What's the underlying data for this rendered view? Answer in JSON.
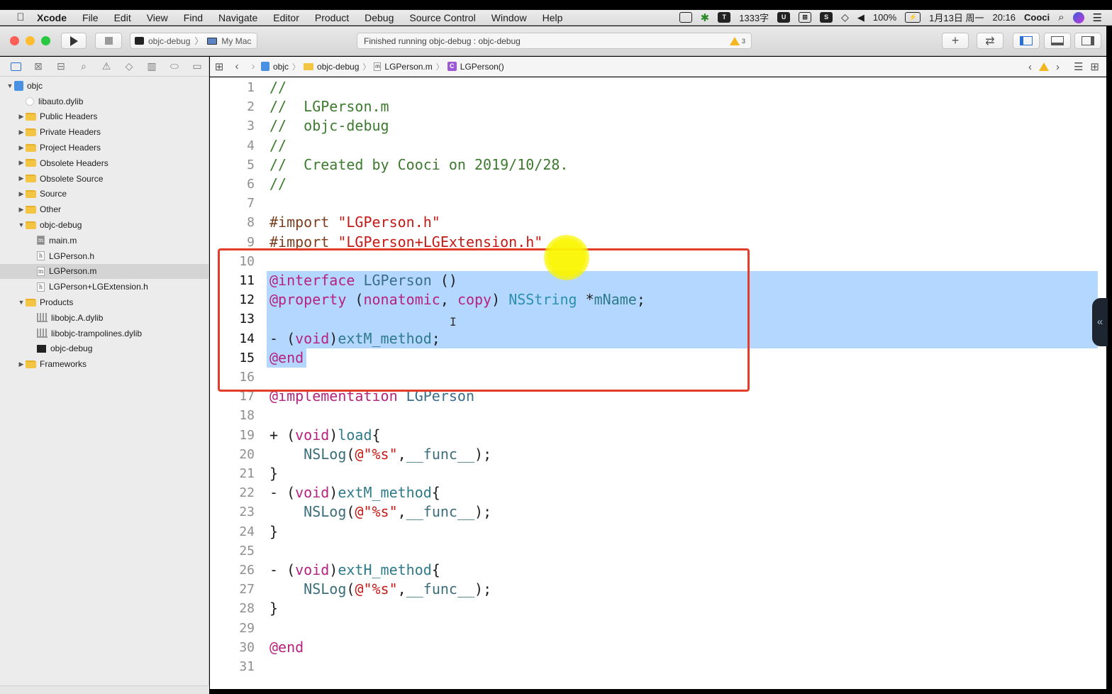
{
  "menubar": {
    "app": "Xcode",
    "items": [
      "File",
      "Edit",
      "View",
      "Find",
      "Navigate",
      "Editor",
      "Product",
      "Debug",
      "Source Control",
      "Window",
      "Help"
    ],
    "status": {
      "word_count": "1333字",
      "battery": "100%",
      "date": "1月13日 周一",
      "time": "20:16",
      "user": "Cooci"
    }
  },
  "toolbar": {
    "scheme": "objc-debug",
    "destination": "My Mac",
    "activity_text": "Finished running objc-debug : objc-debug",
    "warning_count": "3",
    "colors": {
      "close": "#fd5f57",
      "minimize": "#febc2e",
      "zoom": "#28c840"
    }
  },
  "navigator": {
    "tree": [
      {
        "label": "objc",
        "kind": "project",
        "disclosure": "open",
        "depth": 0
      },
      {
        "label": "libauto.dylib",
        "kind": "dylib",
        "disclosure": "none",
        "depth": 1
      },
      {
        "label": "Public Headers",
        "kind": "folder",
        "disclosure": "closed",
        "depth": 1
      },
      {
        "label": "Private Headers",
        "kind": "folder",
        "disclosure": "closed",
        "depth": 1
      },
      {
        "label": "Project Headers",
        "kind": "folder",
        "disclosure": "closed",
        "depth": 1
      },
      {
        "label": "Obsolete Headers",
        "kind": "folder",
        "disclosure": "closed",
        "depth": 1
      },
      {
        "label": "Obsolete Source",
        "kind": "folder",
        "disclosure": "closed",
        "depth": 1
      },
      {
        "label": "Source",
        "kind": "folder",
        "disclosure": "closed",
        "depth": 1
      },
      {
        "label": "Other",
        "kind": "folder",
        "disclosure": "closed",
        "depth": 1
      },
      {
        "label": "objc-debug",
        "kind": "folder",
        "disclosure": "open",
        "depth": 1
      },
      {
        "label": "main.m",
        "kind": "file-m-dark",
        "disclosure": "none",
        "depth": 2
      },
      {
        "label": "LGPerson.h",
        "kind": "file-h",
        "disclosure": "none",
        "depth": 2
      },
      {
        "label": "LGPerson.m",
        "kind": "file-m",
        "disclosure": "none",
        "depth": 2,
        "selected": true
      },
      {
        "label": "LGPerson+LGExtension.h",
        "kind": "file-h",
        "disclosure": "none",
        "depth": 2
      },
      {
        "label": "Products",
        "kind": "folder",
        "disclosure": "open",
        "depth": 1
      },
      {
        "label": "libobjc.A.dylib",
        "kind": "lib",
        "disclosure": "none",
        "depth": 2
      },
      {
        "label": "libobjc-trampolines.dylib",
        "kind": "lib",
        "disclosure": "none",
        "depth": 2
      },
      {
        "label": "objc-debug",
        "kind": "binary",
        "disclosure": "none",
        "depth": 2
      },
      {
        "label": "Frameworks",
        "kind": "folder",
        "disclosure": "closed",
        "depth": 1
      }
    ]
  },
  "jumpbar": {
    "crumbs": [
      "objc",
      "objc-debug",
      "LGPerson.m",
      "LGPerson()"
    ]
  },
  "editor": {
    "selection_lines": [
      11,
      15
    ],
    "lines": [
      {
        "n": "1",
        "tokens": [
          [
            "comment",
            "//"
          ]
        ]
      },
      {
        "n": "2",
        "tokens": [
          [
            "comment",
            "//  LGPerson.m"
          ]
        ]
      },
      {
        "n": "3",
        "tokens": [
          [
            "comment",
            "//  objc-debug"
          ]
        ]
      },
      {
        "n": "4",
        "tokens": [
          [
            "comment",
            "//"
          ]
        ]
      },
      {
        "n": "5",
        "tokens": [
          [
            "comment",
            "//  Created by Cooci on 2019/10/28."
          ]
        ]
      },
      {
        "n": "6",
        "tokens": [
          [
            "comment",
            "//"
          ]
        ]
      },
      {
        "n": "7",
        "tokens": []
      },
      {
        "n": "8",
        "tokens": [
          [
            "preproc",
            "#import "
          ],
          [
            "string",
            "\"LGPerson.h\""
          ]
        ]
      },
      {
        "n": "9",
        "tokens": [
          [
            "preproc",
            "#import "
          ],
          [
            "string",
            "\"LGPerson+LGExtension.h\""
          ]
        ]
      },
      {
        "n": "10",
        "tokens": []
      },
      {
        "n": "11",
        "tokens": [
          [
            "keyword",
            "@interface "
          ],
          [
            "class",
            "LGPerson"
          ],
          [
            "plain",
            " ()"
          ]
        ]
      },
      {
        "n": "12",
        "tokens": [
          [
            "keyword",
            "@property "
          ],
          [
            "plain",
            "("
          ],
          [
            "keyword",
            "nonatomic"
          ],
          [
            "plain",
            ", "
          ],
          [
            "keyword",
            "copy"
          ],
          [
            "plain",
            ") "
          ],
          [
            "type",
            "NSString"
          ],
          [
            "plain",
            " *"
          ],
          [
            "method",
            "mName"
          ],
          [
            "plain",
            ";"
          ]
        ]
      },
      {
        "n": "13",
        "tokens": []
      },
      {
        "n": "14",
        "tokens": [
          [
            "plain",
            "- ("
          ],
          [
            "keyword",
            "void"
          ],
          [
            "plain",
            ")"
          ],
          [
            "method",
            "extM_method"
          ],
          [
            "plain",
            ";"
          ]
        ]
      },
      {
        "n": "15",
        "tokens": [
          [
            "keyword",
            "@end"
          ]
        ]
      },
      {
        "n": "16",
        "tokens": []
      },
      {
        "n": "17",
        "tokens": [
          [
            "keyword",
            "@implementation "
          ],
          [
            "class",
            "LGPerson"
          ]
        ]
      },
      {
        "n": "18",
        "tokens": []
      },
      {
        "n": "19",
        "tokens": [
          [
            "plain",
            "+ ("
          ],
          [
            "keyword",
            "void"
          ],
          [
            "plain",
            ")"
          ],
          [
            "method",
            "load"
          ],
          [
            "plain",
            "{"
          ]
        ]
      },
      {
        "n": "20",
        "tokens": [
          [
            "plain",
            "    "
          ],
          [
            "func",
            "NSLog"
          ],
          [
            "plain",
            "("
          ],
          [
            "string",
            "@\"%s\""
          ],
          [
            "plain",
            ","
          ],
          [
            "func",
            "__func__"
          ],
          [
            "plain",
            ");"
          ]
        ]
      },
      {
        "n": "21",
        "tokens": [
          [
            "plain",
            "}"
          ]
        ]
      },
      {
        "n": "22",
        "tokens": [
          [
            "plain",
            "- ("
          ],
          [
            "keyword",
            "void"
          ],
          [
            "plain",
            ")"
          ],
          [
            "method",
            "extM_method"
          ],
          [
            "plain",
            "{"
          ]
        ]
      },
      {
        "n": "23",
        "tokens": [
          [
            "plain",
            "    "
          ],
          [
            "func",
            "NSLog"
          ],
          [
            "plain",
            "("
          ],
          [
            "string",
            "@\"%s\""
          ],
          [
            "plain",
            ","
          ],
          [
            "func",
            "__func__"
          ],
          [
            "plain",
            ");"
          ]
        ]
      },
      {
        "n": "24",
        "tokens": [
          [
            "plain",
            "}"
          ]
        ]
      },
      {
        "n": "25",
        "tokens": []
      },
      {
        "n": "26",
        "tokens": [
          [
            "plain",
            "- ("
          ],
          [
            "keyword",
            "void"
          ],
          [
            "plain",
            ")"
          ],
          [
            "method",
            "extH_method"
          ],
          [
            "plain",
            "{"
          ]
        ]
      },
      {
        "n": "27",
        "tokens": [
          [
            "plain",
            "    "
          ],
          [
            "func",
            "NSLog"
          ],
          [
            "plain",
            "("
          ],
          [
            "string",
            "@\"%s\""
          ],
          [
            "plain",
            ","
          ],
          [
            "func",
            "__func__"
          ],
          [
            "plain",
            ");"
          ]
        ]
      },
      {
        "n": "28",
        "tokens": [
          [
            "plain",
            "}"
          ]
        ]
      },
      {
        "n": "29",
        "tokens": []
      },
      {
        "n": "30",
        "tokens": [
          [
            "keyword",
            "@end"
          ]
        ]
      },
      {
        "n": "31",
        "tokens": []
      }
    ]
  }
}
